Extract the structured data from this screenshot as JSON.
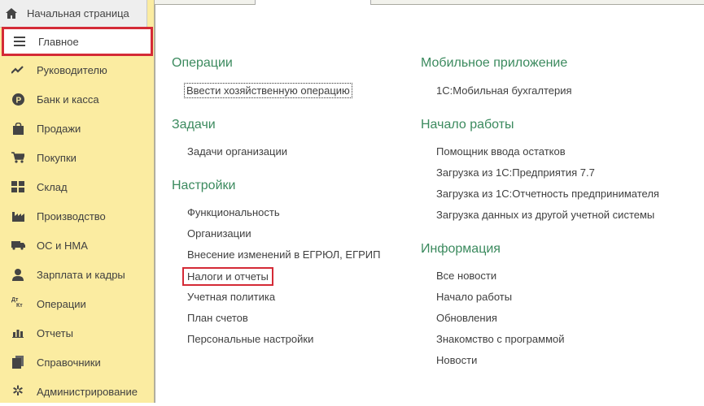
{
  "sidebar": {
    "home": "Начальная страница",
    "items": [
      {
        "label": "Главное",
        "icon": "menu-icon"
      },
      {
        "label": "Руководителю",
        "icon": "trend-icon"
      },
      {
        "label": "Банк и касса",
        "icon": "ruble-icon"
      },
      {
        "label": "Продажи",
        "icon": "bag-icon"
      },
      {
        "label": "Покупки",
        "icon": "cart-icon"
      },
      {
        "label": "Склад",
        "icon": "warehouse-icon"
      },
      {
        "label": "Производство",
        "icon": "factory-icon"
      },
      {
        "label": "ОС и НМА",
        "icon": "truck-icon"
      },
      {
        "label": "Зарплата и кадры",
        "icon": "person-icon"
      },
      {
        "label": "Операции",
        "icon": "dt-kt-icon",
        "icon_text": [
          "Дт",
          "Кт"
        ]
      },
      {
        "label": "Отчеты",
        "icon": "bar-chart-icon"
      },
      {
        "label": "Справочники",
        "icon": "books-icon"
      },
      {
        "label": "Администрирование",
        "icon": "gear-icon"
      }
    ]
  },
  "main": {
    "left": [
      {
        "title": "Операции",
        "links": [
          "Ввести хозяйственную операцию"
        ]
      },
      {
        "title": "Задачи",
        "links": [
          "Задачи организации"
        ]
      },
      {
        "title": "Настройки",
        "links": [
          "Функциональность",
          "Организации",
          "Внесение изменений в ЕГРЮЛ, ЕГРИП",
          "Налоги и отчеты",
          "Учетная политика",
          "План счетов",
          "Персональные настройки"
        ]
      }
    ],
    "right": [
      {
        "title": "Мобильное приложение",
        "links": [
          "1С:Мобильная бухгалтерия"
        ]
      },
      {
        "title": "Начало работы",
        "links": [
          "Помощник ввода остатков",
          "Загрузка из 1С:Предприятия 7.7",
          "Загрузка из 1С:Отчетность предпринимателя",
          "Загрузка данных из другой учетной системы"
        ]
      },
      {
        "title": "Информация",
        "links": [
          "Все новости",
          "Начало работы",
          "Обновления",
          "Знакомство с программой",
          "Новости"
        ]
      }
    ]
  },
  "colors": {
    "sidebar": "#fbeca1",
    "section": "#3b8a5e",
    "highlight": "#d42a36"
  }
}
